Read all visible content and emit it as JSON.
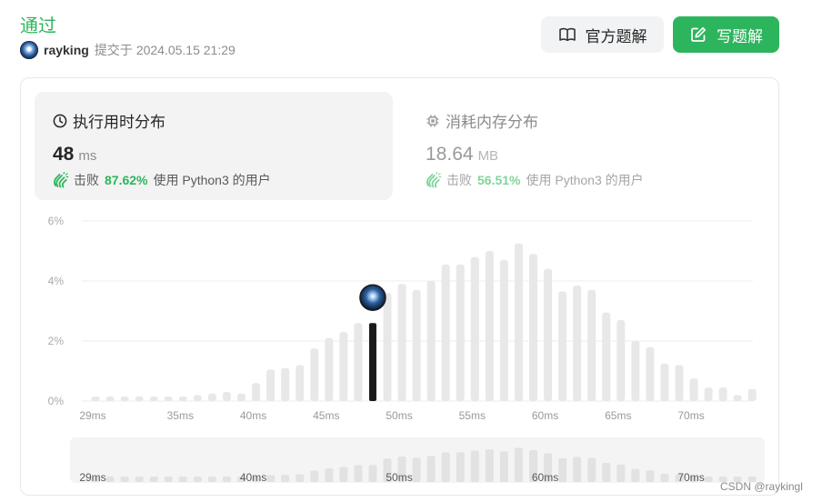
{
  "status": {
    "title": "通过"
  },
  "submission": {
    "username": "rayking",
    "prefix": "提交于",
    "time": "2024.05.15 21:29"
  },
  "actions": {
    "official_solution": "官方题解",
    "write_solution": "写题解"
  },
  "runtime_panel": {
    "title": "执行用时分布",
    "value": "48",
    "unit": "ms",
    "beats_label": "击败",
    "beats_pct": "87.62%",
    "suffix": "使用 Python3 的用户"
  },
  "memory_panel": {
    "title": "消耗内存分布",
    "value": "18.64",
    "unit": "MB",
    "beats_label": "击败",
    "beats_pct": "56.51%",
    "suffix": "使用 Python3 的用户"
  },
  "colors": {
    "accent_green": "#2db55d",
    "bar_gray": "#e8e8e8",
    "highlight_bar": "#1a1a1a"
  },
  "chart_data": {
    "type": "bar",
    "title": "",
    "xlabel": "",
    "ylabel": "",
    "yticks": [
      "6%",
      "4%",
      "2%",
      "0%"
    ],
    "ylim": [
      0,
      6
    ],
    "grid": true,
    "xtick_labels": [
      "29ms",
      "35ms",
      "40ms",
      "45ms",
      "50ms",
      "55ms",
      "60ms",
      "65ms",
      "70ms"
    ],
    "x_ms": [
      29,
      30,
      31,
      32,
      33,
      34,
      35,
      36,
      37,
      38,
      39,
      40,
      41,
      42,
      43,
      44,
      45,
      46,
      47,
      48,
      49,
      50,
      51,
      52,
      53,
      54,
      55,
      56,
      57,
      58,
      59,
      60,
      61,
      62,
      63,
      64,
      65,
      66,
      67,
      68,
      69,
      70,
      71,
      72,
      73,
      74
    ],
    "values": [
      0.15,
      0.15,
      0.15,
      0.15,
      0.15,
      0.15,
      0.15,
      0.2,
      0.25,
      0.3,
      0.25,
      0.6,
      1.05,
      1.1,
      1.2,
      1.75,
      2.1,
      2.3,
      2.6,
      2.6,
      3.6,
      3.9,
      3.7,
      4.0,
      4.55,
      4.55,
      4.8,
      5.0,
      4.7,
      5.25,
      4.9,
      4.4,
      3.65,
      3.85,
      3.7,
      2.95,
      2.7,
      2.0,
      1.8,
      1.25,
      1.2,
      0.75,
      0.45,
      0.45,
      0.2,
      0.4
    ],
    "highlight_x": 48,
    "range_selector": {
      "tick_labels": [
        "29ms",
        "40ms",
        "50ms",
        "60ms",
        "70ms"
      ]
    }
  },
  "watermark": "CSDN @raykingl"
}
